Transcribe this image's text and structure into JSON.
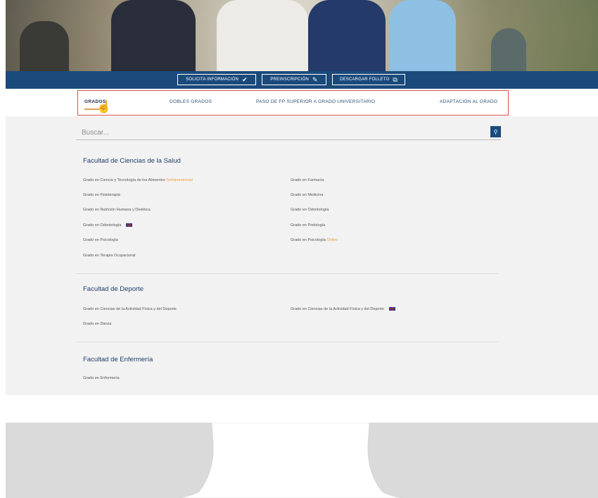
{
  "buttons": {
    "request_info": "SOLICITA INFORMACIÓN",
    "preregistration": "PREINSCRIPCIÓN",
    "download_brochure": "DESCARGAR FOLLETO"
  },
  "tabs": [
    {
      "label": "GRADOS",
      "active": true
    },
    {
      "label": "DOBLES GRADOS",
      "active": false
    },
    {
      "label": "PASO DE FP SUPERIOR A GRADO UNIVERSITARIO",
      "active": false
    },
    {
      "label": "ADAPTACIÓN AL GRADO",
      "active": false
    }
  ],
  "search": {
    "placeholder": "Buscar..."
  },
  "faculties": [
    {
      "title": "Facultad de Ciencias de la Salud",
      "left": [
        {
          "label": "Grado en Ciencia y Tecnología de los Alimentos",
          "tag": "Semipresencial"
        },
        {
          "label": "Grado en Fisioterapia"
        },
        {
          "label": "Grado en Nutrición Humana y Dietética"
        },
        {
          "label": "Grado en Odontología",
          "flag": "uk-flag"
        },
        {
          "label": "Grado en Psicología"
        },
        {
          "label": "Grado en Terapia Ocupacional"
        }
      ],
      "right": [
        {
          "label": "Grado en Farmacia"
        },
        {
          "label": "Grado en Medicina"
        },
        {
          "label": "Grado en Odontología"
        },
        {
          "label": "Grado en Podología"
        },
        {
          "label": "Grado en Psicología",
          "tag": "Online"
        }
      ]
    },
    {
      "title": "Facultad de Deporte",
      "left": [
        {
          "label": "Grado en Ciencias de la Actividad Física y del Deporte"
        },
        {
          "label": "Grado en Danza"
        }
      ],
      "right": [
        {
          "label": "Grado en Ciencias de la Actividad Física y del Deporte",
          "flag": "uk-flag"
        }
      ]
    },
    {
      "title": "Facultad de Enfermería",
      "left": [
        {
          "label": "Grado en Enfermería"
        }
      ],
      "right": []
    }
  ],
  "colors": {
    "primary": "#1a4a7c",
    "accent": "#e8a03c",
    "highlight_border": "#d9534f"
  }
}
